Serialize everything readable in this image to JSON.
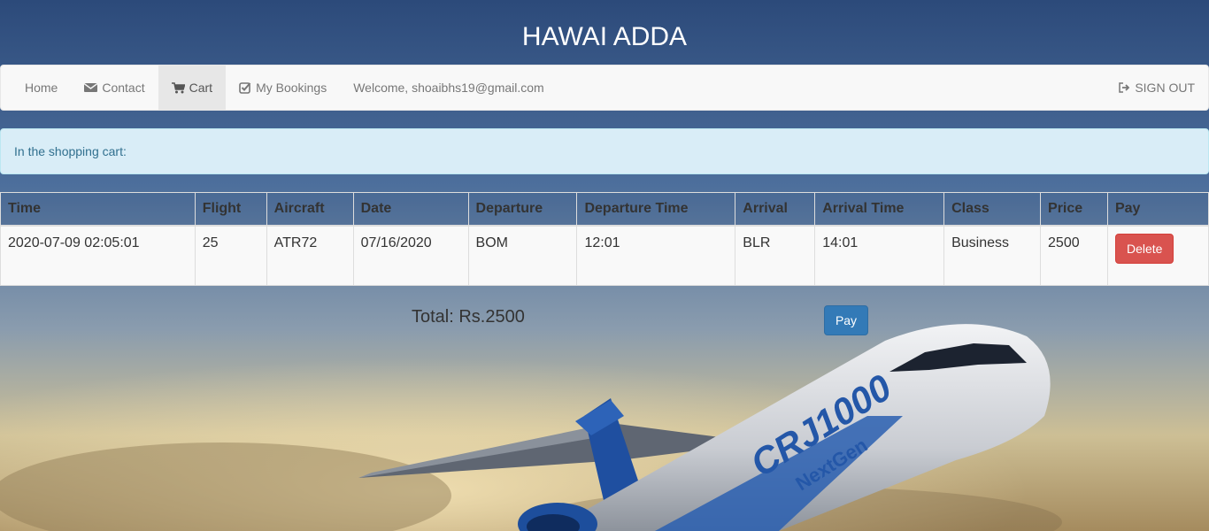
{
  "site": {
    "title": "HAWAI ADDA"
  },
  "nav": {
    "home": "Home",
    "contact": "Contact",
    "cart": "Cart",
    "bookings": "My Bookings",
    "welcome": "Welcome, shoaibhs19@gmail.com",
    "signout": "SIGN OUT"
  },
  "alert": {
    "text": "In the shopping cart:"
  },
  "table": {
    "headers": [
      "Time",
      "Flight",
      "Aircraft",
      "Date",
      "Departure",
      "Departure Time",
      "Arrival",
      "Arrival Time",
      "Class",
      "Price",
      "Pay"
    ],
    "rows": [
      {
        "time": "2020-07-09 02:05:01",
        "flight": "25",
        "aircraft": "ATR72",
        "date": "07/16/2020",
        "departure": "BOM",
        "departure_time": "12:01",
        "arrival": "BLR",
        "arrival_time": "14:01",
        "class": "Business",
        "price": "2500",
        "action": "Delete"
      }
    ]
  },
  "total": {
    "text": "Total: Rs.2500"
  },
  "pay_button": "Pay",
  "aircraft_livery": {
    "brand": "CRJ1000",
    "sub": "NextGen"
  },
  "colors": {
    "danger": "#d9534f",
    "primary": "#337ab7",
    "info_bg": "#d9edf7",
    "info_text": "#31708f",
    "navbar_bg": "#f8f8f8",
    "sky_top": "#2d4f80",
    "sky_bottom": "#d9c38e"
  },
  "icons": [
    "envelope-icon",
    "cart-icon",
    "check-square-icon",
    "sign-out-icon"
  ]
}
